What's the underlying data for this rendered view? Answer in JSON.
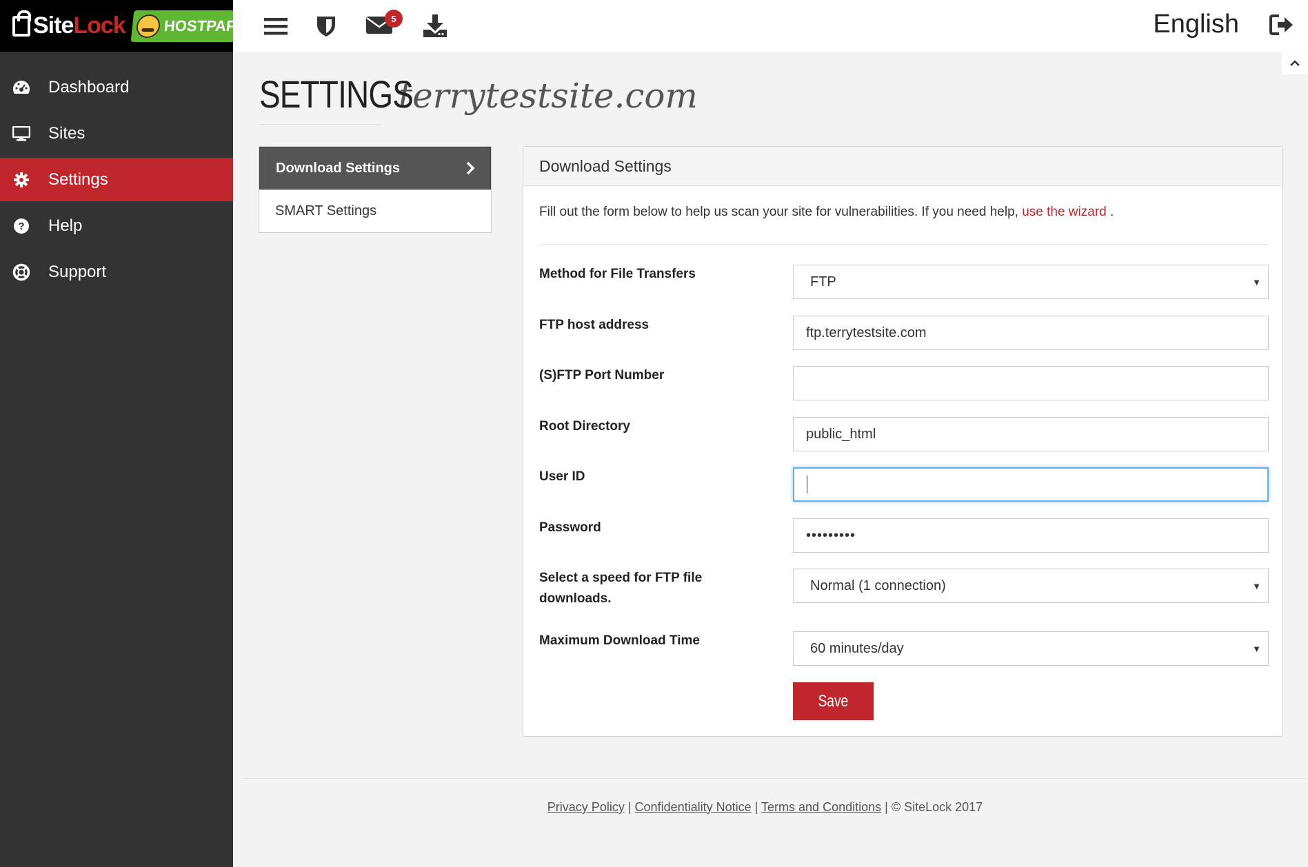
{
  "brand": {
    "sitelock_part1": "Site",
    "sitelock_part2": "Lock",
    "hostpapa": "HOSTPAPA"
  },
  "sidebar": {
    "items": [
      {
        "label": "Dashboard",
        "icon": "dashboard-icon"
      },
      {
        "label": "Sites",
        "icon": "monitor-icon"
      },
      {
        "label": "Settings",
        "icon": "gear-icon",
        "active": true
      },
      {
        "label": "Help",
        "icon": "question-circle-icon"
      },
      {
        "label": "Support",
        "icon": "lifebuoy-icon"
      }
    ]
  },
  "topbar": {
    "icons": [
      "menu-icon",
      "shield-icon",
      "envelope-icon",
      "download-icon"
    ],
    "messages_count": "5",
    "language": "English"
  },
  "page": {
    "title": "SETTINGS",
    "site": "terrytestsite.com"
  },
  "subnav": {
    "items": [
      {
        "label": "Download Settings",
        "active": true
      },
      {
        "label": "SMART Settings"
      }
    ]
  },
  "panel": {
    "heading": "Download Settings",
    "intro_text": "Fill out the form below to help us scan your site for vulnerabilities. If you need help,",
    "intro_link": "use the wizard",
    "intro_end": ".",
    "fields": {
      "method": {
        "label": "Method for File Transfers",
        "value": "FTP"
      },
      "host": {
        "label": "FTP host address",
        "value": "ftp.terrytestsite.com"
      },
      "port": {
        "label": "(S)FTP Port Number",
        "value": ""
      },
      "root": {
        "label": "Root Directory",
        "value": "public_html"
      },
      "user": {
        "label": "User ID",
        "value": ""
      },
      "password": {
        "label": "Password",
        "value": "•••••••••"
      },
      "speed": {
        "label_line1": "Select a speed for FTP file",
        "label_line2": "downloads.",
        "value": "Normal (1 connection)"
      },
      "max_time": {
        "label": "Maximum Download Time",
        "value": "60 minutes/day"
      }
    },
    "save_label": "Save"
  },
  "footer": {
    "privacy": "Privacy Policy",
    "confidentiality": "Confidentiality Notice",
    "terms": "Terms and Conditions",
    "copyright": "© SiteLock 2017",
    "separator": "|"
  },
  "colors": {
    "accent": "#c0272d",
    "sidebar_bg": "#333333",
    "focus": "#66afe9"
  }
}
